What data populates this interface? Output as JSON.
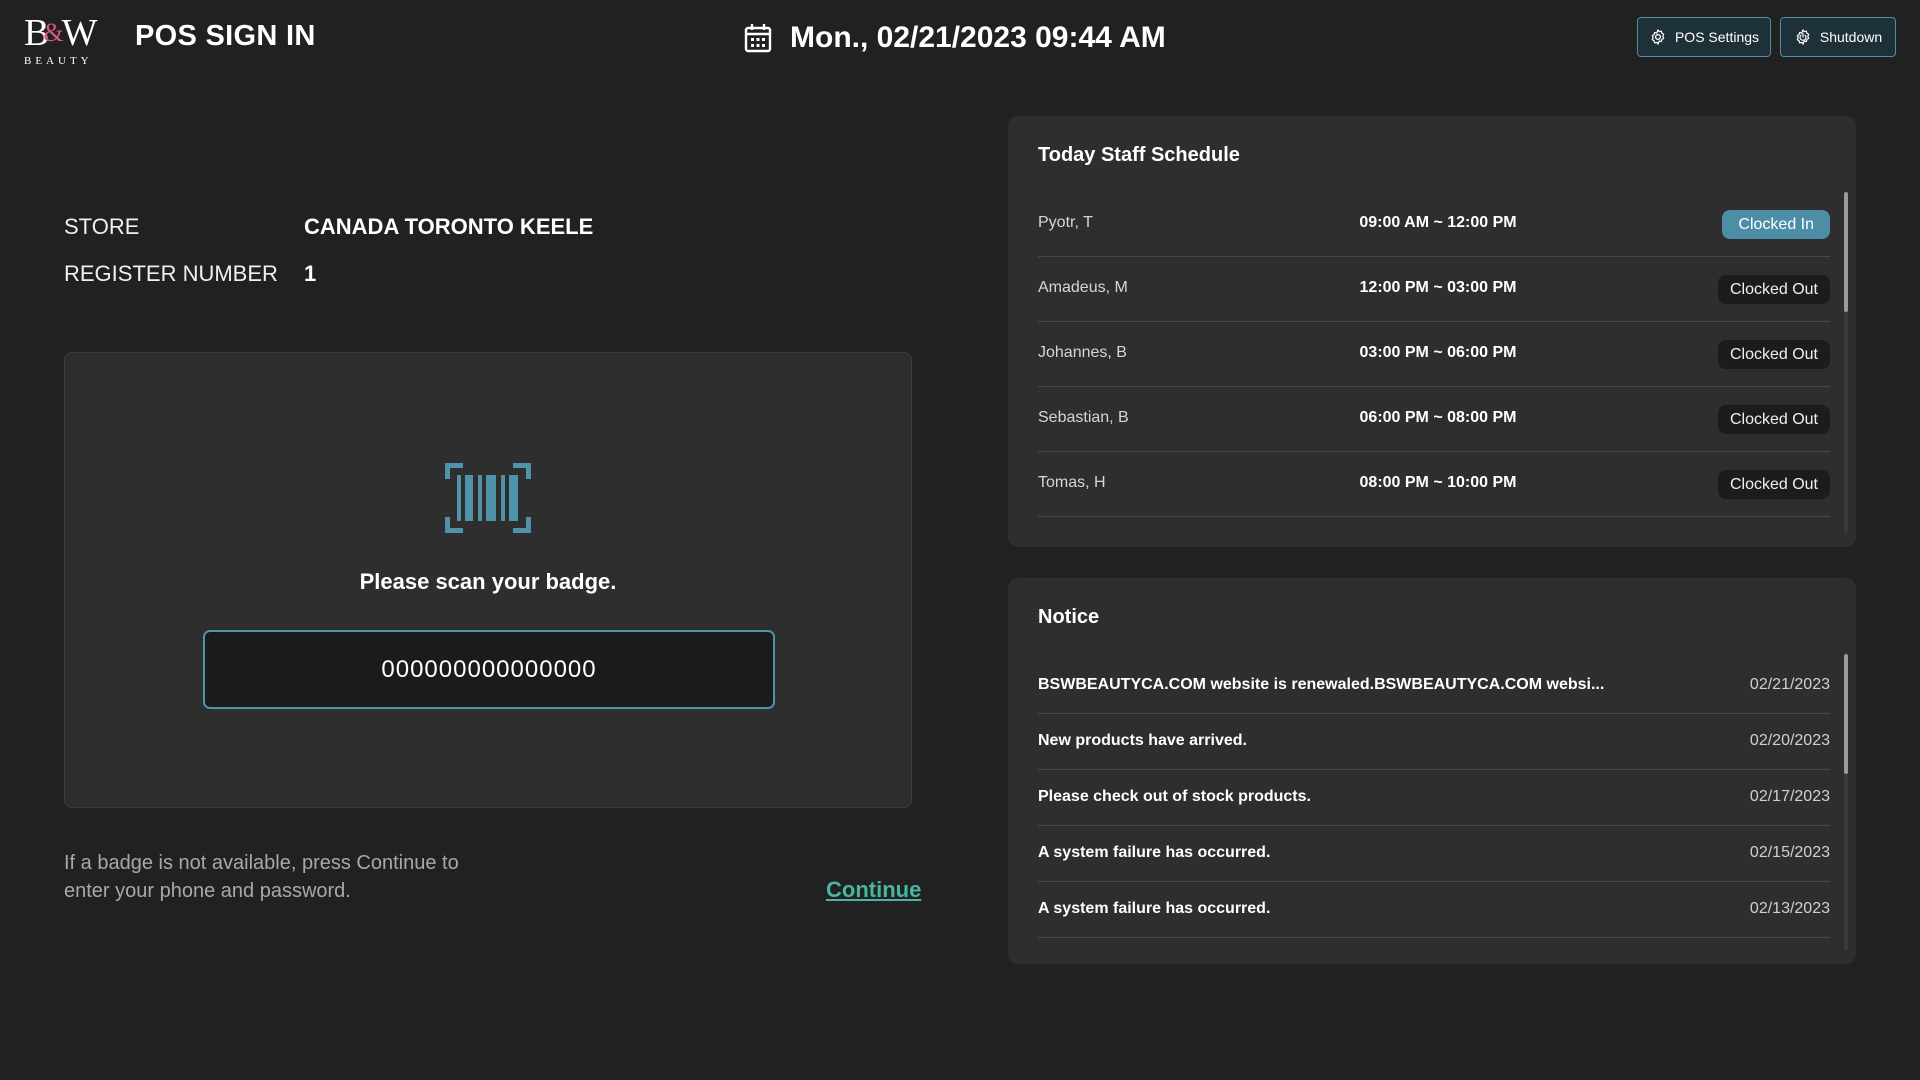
{
  "header": {
    "logo_mark": "BW",
    "logo_ampersand": "&",
    "logo_sub": "BEAUTY",
    "title": "POS SIGN IN",
    "datetime": "Mon., 02/21/2023 09:44 AM",
    "settings_label": "POS Settings",
    "shutdown_label": "Shutdown"
  },
  "store_info": {
    "store_label": "STORE",
    "store_value": "CANADA TORONTO KEELE",
    "register_label": "REGISTER NUMBER",
    "register_value": "1"
  },
  "scan": {
    "prompt": "Please scan your badge.",
    "badge_value": "000000000000000"
  },
  "help": {
    "text": "If a badge is not available, press Continue to enter your phone and password.",
    "continue_label": "Continue"
  },
  "schedule": {
    "title": "Today Staff Schedule",
    "rows": [
      {
        "name": "Pyotr, T",
        "time": "09:00 AM ~ 12:00 PM",
        "status": "Clocked In"
      },
      {
        "name": "Amadeus, M",
        "time": "12:00 PM ~ 03:00 PM",
        "status": "Clocked Out"
      },
      {
        "name": "Johannes, B",
        "time": "03:00 PM ~ 06:00 PM",
        "status": "Clocked Out"
      },
      {
        "name": "Sebastian, B",
        "time": "06:00 PM ~ 08:00 PM",
        "status": "Clocked Out"
      },
      {
        "name": "Tomas, H",
        "time": "08:00 PM ~ 10:00 PM",
        "status": "Clocked Out"
      }
    ]
  },
  "notice": {
    "title": "Notice",
    "rows": [
      {
        "text": "BSWBEAUTYCA.COM website is renewaled.BSWBEAUTYCA.COM websi...",
        "date": "02/21/2023"
      },
      {
        "text": "New products have arrived.",
        "date": "02/20/2023"
      },
      {
        "text": "Please check out of stock products.",
        "date": "02/17/2023"
      },
      {
        "text": "A system failure has occurred.",
        "date": "02/15/2023"
      },
      {
        "text": "A system failure has occurred.",
        "date": "02/13/2023"
      }
    ]
  },
  "colors": {
    "accent": "#4f93ab",
    "link": "#49b4a0",
    "clocked_in": "#4d8ea7",
    "logo_pink": "#d8587e"
  }
}
